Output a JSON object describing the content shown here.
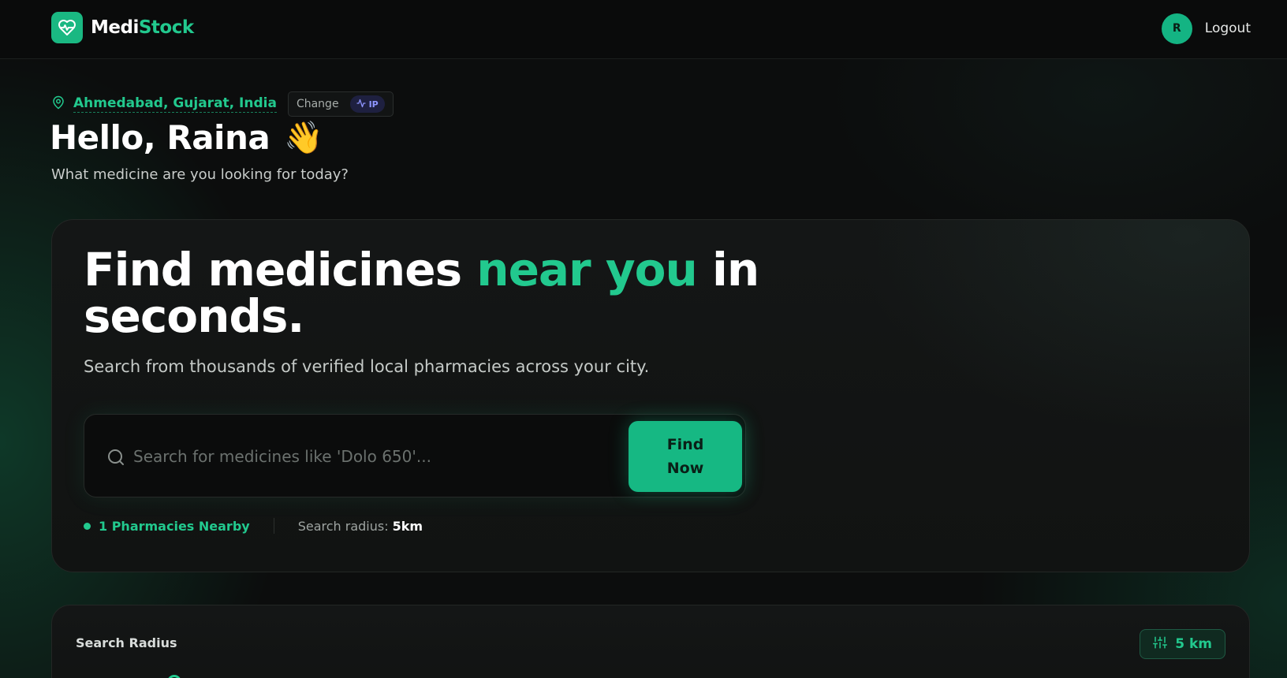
{
  "header": {
    "brand_part1": "Medi",
    "brand_part2": "Stock",
    "brand_icon": "heart-pulse-icon",
    "avatar_initial": "R",
    "logout_label": "Logout"
  },
  "greeting": {
    "location": "Ahmedabad, Gujarat, India",
    "change_label": "Change",
    "ip_label": "IP",
    "hello": "Hello, Raina",
    "wave_emoji": "👋",
    "subtitle": "What medicine are you looking for today?"
  },
  "hero": {
    "title_part1": "Find medicines ",
    "title_accent": "near you",
    "title_part2": " in seconds.",
    "subtitle": "Search from thousands of verified local pharmacies across your city.",
    "search_placeholder": "Search for medicines like 'Dolo 650'...",
    "search_value": "",
    "find_button": "Find Now",
    "pharmacies_nearby": "1 Pharmacies Nearby",
    "radius_label": "Search radius:",
    "radius_value": "5km"
  },
  "radius_panel": {
    "title": "Search Radius",
    "value_label": "5 km",
    "icon": "sliders-icon"
  },
  "colors": {
    "accent": "#22c98e",
    "button": "#16b883",
    "background": "#0c0d0d",
    "ip_badge_text": "#8e95ff"
  }
}
